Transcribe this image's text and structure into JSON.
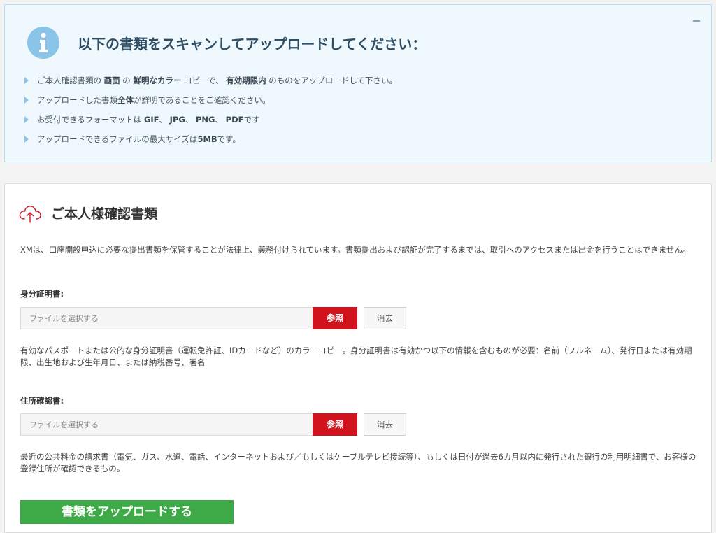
{
  "info": {
    "title": "以下の書類をスキャンしてアップロードしてください：",
    "collapse_icon": "minus-icon",
    "icon": "info-icon",
    "items": [
      [
        {
          "t": "ご本人確認書類の "
        },
        {
          "t": "画面",
          "b": true
        },
        {
          "t": " の "
        },
        {
          "t": "鮮明なカラー",
          "b": true
        },
        {
          "t": " コピーで、 "
        },
        {
          "t": "有効期限内",
          "b": true
        },
        {
          "t": " のものをアップロードして下さい。"
        }
      ],
      [
        {
          "t": "アップロードした書類"
        },
        {
          "t": "全体",
          "b": true
        },
        {
          "t": "が鮮明であることをご確認ください。"
        }
      ],
      [
        {
          "t": "お受付できるフォーマットは "
        },
        {
          "t": "GIF",
          "b": true
        },
        {
          "t": "、 "
        },
        {
          "t": "JPG",
          "b": true
        },
        {
          "t": "、 "
        },
        {
          "t": "PNG",
          "b": true
        },
        {
          "t": "、 "
        },
        {
          "t": "PDF",
          "b": true
        },
        {
          "t": "です"
        }
      ],
      [
        {
          "t": "アップロードできるファイルの最大サイズは"
        },
        {
          "t": "5MB",
          "b": true
        },
        {
          "t": "です。"
        }
      ]
    ]
  },
  "card": {
    "icon": "cloud-upload-icon",
    "title": "ご本人様確認書類",
    "intro": "XMは、口座開設申込に必要な提出書類を保管することが法律上、義務付けられています。書類提出および認証が完了するまでは、取引へのアクセスまたは出金を行うことはできません。",
    "id_doc": {
      "label": "身分証明書:",
      "placeholder": "ファイルを選択する",
      "browse": "参照",
      "clear": "消去",
      "help": "有効なパスポートまたは公的な身分証明書（運転免許証、IDカードなど）のカラーコピー。身分証明書は有効かつ以下の情報を含むものが必要：名前（フルネーム）、発行日または有効期限、出生地および生年月日、または納税番号、署名"
    },
    "address_doc": {
      "label": "住所確認書:",
      "placeholder": "ファイルを選択する",
      "browse": "参照",
      "clear": "消去",
      "help": "最近の公共料金の請求書（電気、ガス、水道、電話、インターネットおよび／もしくはケーブルテレビ接続等）、もしくは日付が過去6カ月以内に発行された銀行の利用明細書で、お客様の登録住所が確認できるもの。"
    },
    "upload_button": "書類をアップロードする"
  },
  "colors": {
    "info_bg": "#eef8fd",
    "info_border": "#b5dcf0",
    "accent_blue": "#8ac4e8",
    "brand_red": "#d0131c",
    "upload_green": "#3daa47"
  }
}
